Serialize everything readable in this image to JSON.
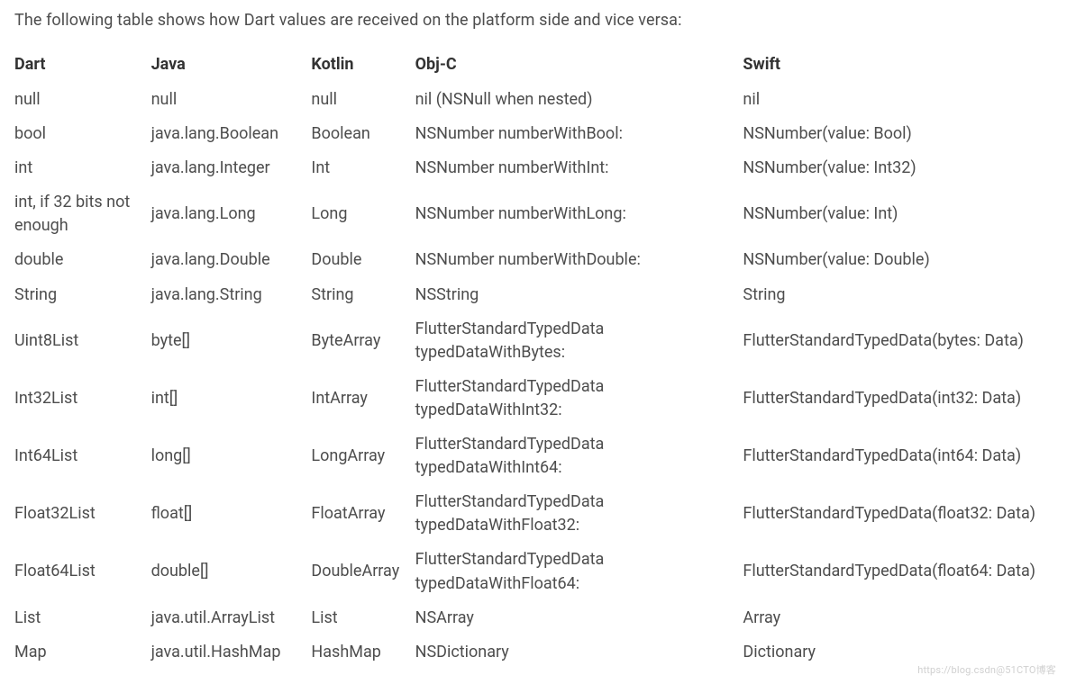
{
  "intro": "The following table shows how Dart values are received on the platform side and vice versa:",
  "headers": [
    "Dart",
    "Java",
    "Kotlin",
    "Obj-C",
    "Swift"
  ],
  "rows": [
    {
      "dart": "null",
      "java": "null",
      "kotlin": "null",
      "objc": "nil (NSNull when nested)",
      "swift": "nil"
    },
    {
      "dart": "bool",
      "java": "java.lang.Boolean",
      "kotlin": "Boolean",
      "objc": "NSNumber numberWithBool:",
      "swift": "NSNumber(value: Bool)"
    },
    {
      "dart": "int",
      "java": "java.lang.Integer",
      "kotlin": "Int",
      "objc": "NSNumber numberWithInt:",
      "swift": "NSNumber(value: Int32)"
    },
    {
      "dart": "int, if 32 bits not enough",
      "java": "java.lang.Long",
      "kotlin": "Long",
      "objc": "NSNumber numberWithLong:",
      "swift": "NSNumber(value: Int)"
    },
    {
      "dart": "double",
      "java": "java.lang.Double",
      "kotlin": "Double",
      "objc": "NSNumber numberWithDouble:",
      "swift": "NSNumber(value: Double)"
    },
    {
      "dart": "String",
      "java": "java.lang.String",
      "kotlin": "String",
      "objc": "NSString",
      "swift": "String"
    },
    {
      "dart": "Uint8List",
      "java": "byte[]",
      "kotlin": "ByteArray",
      "objc": "FlutterStandardTypedData typedDataWithBytes:",
      "swift": "FlutterStandardTypedData(bytes: Data)"
    },
    {
      "dart": "Int32List",
      "java": "int[]",
      "kotlin": "IntArray",
      "objc": "FlutterStandardTypedData typedDataWithInt32:",
      "swift": "FlutterStandardTypedData(int32: Data)"
    },
    {
      "dart": "Int64List",
      "java": "long[]",
      "kotlin": "LongArray",
      "objc": "FlutterStandardTypedData typedDataWithInt64:",
      "swift": "FlutterStandardTypedData(int64: Data)"
    },
    {
      "dart": "Float32List",
      "java": "float[]",
      "kotlin": "FloatArray",
      "objc": "FlutterStandardTypedData typedDataWithFloat32:",
      "swift": "FlutterStandardTypedData(float32: Data)"
    },
    {
      "dart": "Float64List",
      "java": "double[]",
      "kotlin": "DoubleArray",
      "objc": "FlutterStandardTypedData typedDataWithFloat64:",
      "swift": "FlutterStandardTypedData(float64: Data)"
    },
    {
      "dart": "List",
      "java": "java.util.ArrayList",
      "kotlin": "List",
      "objc": "NSArray",
      "swift": "Array"
    },
    {
      "dart": "Map",
      "java": "java.util.HashMap",
      "kotlin": "HashMap",
      "objc": "NSDictionary",
      "swift": "Dictionary"
    }
  ],
  "watermark": "https://blog.csdn@51CTO博客"
}
